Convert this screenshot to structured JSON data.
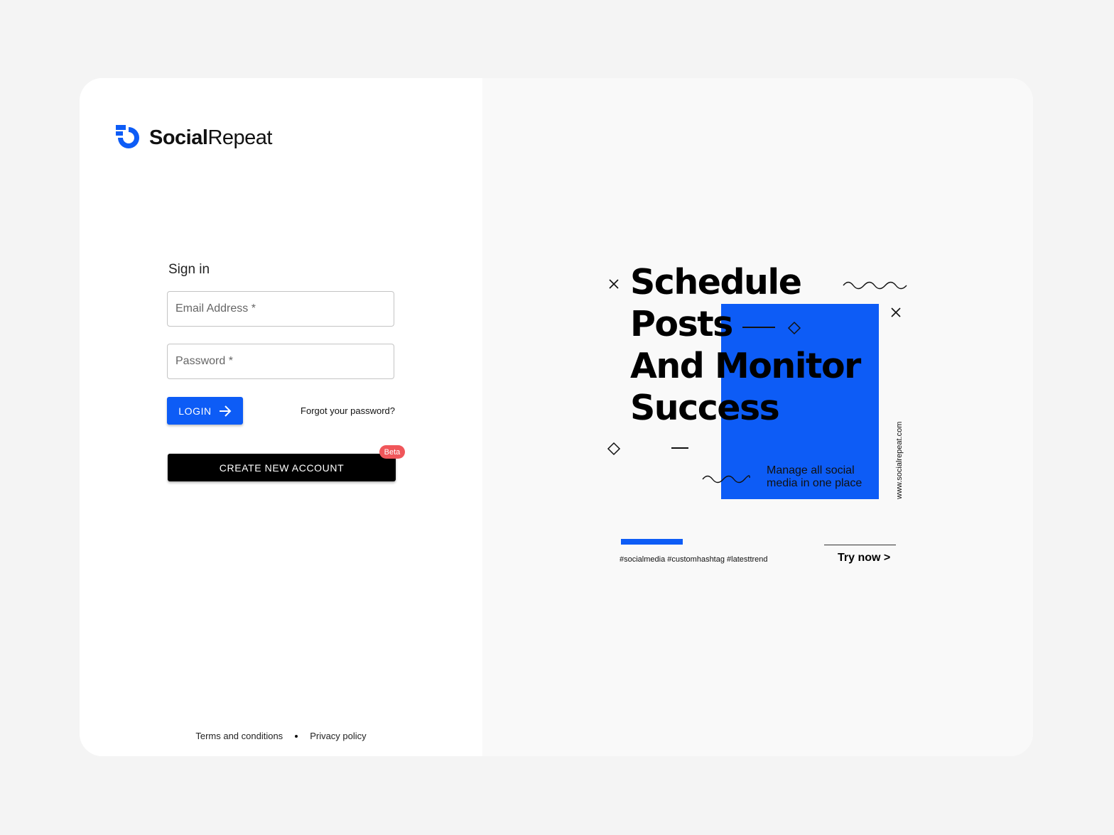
{
  "brand": {
    "name_bold": "Social",
    "name_regular": "Repeat",
    "accent_color": "#0d5cf6"
  },
  "signin": {
    "title": "Sign in",
    "email_placeholder": "Email Address *",
    "password_placeholder": "Password *",
    "login_label": "LOGIN",
    "forgot_label": "Forgot your password?",
    "create_account_label": "CREATE NEW ACCOUNT",
    "beta_badge": "Beta"
  },
  "footer": {
    "terms": "Terms and conditions",
    "privacy": "Privacy policy"
  },
  "promo": {
    "headline_lines": [
      "Schedule",
      "Posts",
      "And Monitor",
      "Success"
    ],
    "tagline_line1": "Manage all social",
    "tagline_line2": "media in one place",
    "url": "www.socialrepeat.com",
    "hashtags": "#socialmedia #customhashtag #latesttrend",
    "cta": "Try now  >"
  }
}
